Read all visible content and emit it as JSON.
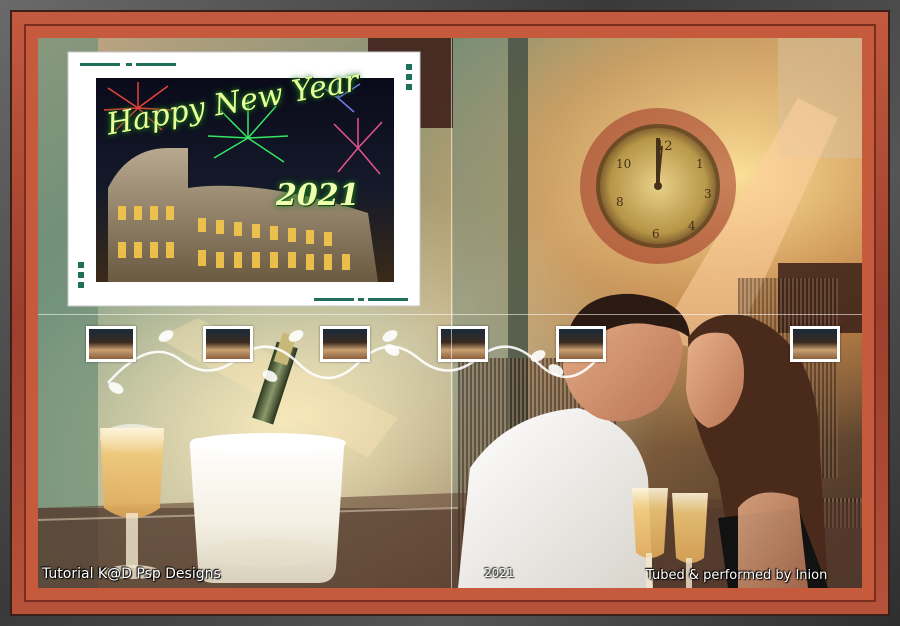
{
  "card": {
    "greeting": "Happy New Year",
    "year": "2021"
  },
  "credits": {
    "left": "Tutorial K@D Psp Designs",
    "right": "Tubed & performed by Inion",
    "center": "2021"
  },
  "palette": {
    "frame_red": "#c65a3c",
    "neon_green": "#c8ff8a",
    "card_accent": "#1f6f5a"
  },
  "thumbnail_count": 6
}
